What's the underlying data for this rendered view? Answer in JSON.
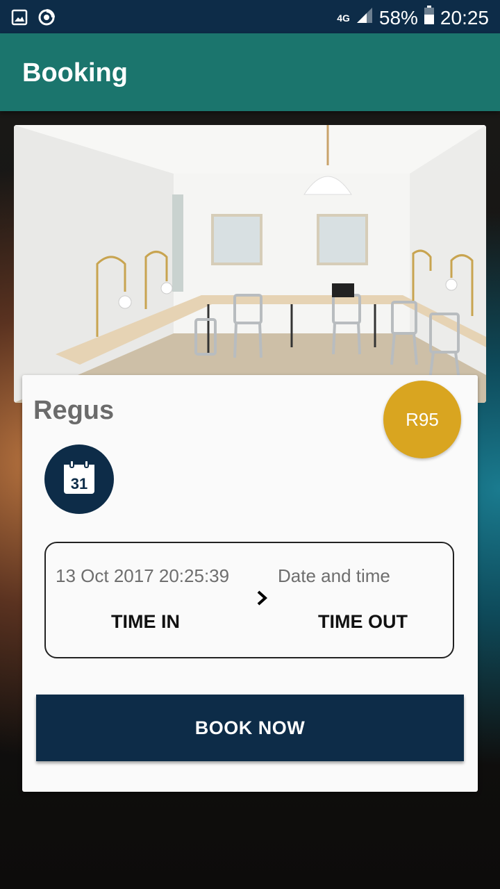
{
  "status_bar": {
    "network": "4G",
    "battery": "58%",
    "time": "20:25"
  },
  "app_bar": {
    "title": "Booking"
  },
  "listing": {
    "name": "Regus",
    "price": "R95"
  },
  "time_selector": {
    "time_in_value": "13 Oct 2017 20:25:39",
    "time_out_value": "Date and time",
    "time_in_label": "TIME IN",
    "time_out_label": "TIME OUT"
  },
  "actions": {
    "book_label": "BOOK NOW"
  },
  "colors": {
    "status_bar": "#0d2c48",
    "app_bar": "#1b756d",
    "accent_navy": "#0d2c48",
    "price_badge": "#d9a520"
  },
  "icons": {
    "status_left": [
      "gallery-icon",
      "sync-icon"
    ],
    "status_right": [
      "signal-icon",
      "battery-icon"
    ],
    "calendar": "calendar-icon",
    "arrow": "chevron-right-icon"
  }
}
